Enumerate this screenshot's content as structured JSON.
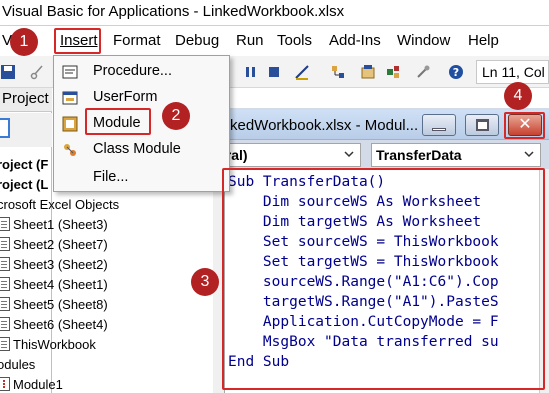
{
  "window": {
    "title": "Visual Basic for Applications - LinkedWorkbook.xlsx"
  },
  "menu": {
    "items": [
      "Insert",
      "Format",
      "Debug",
      "Run",
      "Tools",
      "Add-Ins",
      "Window",
      "Help"
    ],
    "clipped_first": "V"
  },
  "toolbar": {
    "position": "Ln 11, Col"
  },
  "insert_menu": {
    "items": [
      "Procedure...",
      "UserForm",
      "Module",
      "Class Module",
      "File..."
    ]
  },
  "project": {
    "header": "Project",
    "tree": [
      "roject (F",
      "roject (L",
      "crosoft Excel Objects",
      "Sheet1 (Sheet3)",
      "Sheet2 (Sheet7)",
      "Sheet3 (Sheet2)",
      "Sheet4 (Sheet1)",
      "Sheet5 (Sheet8)",
      "Sheet6 (Sheet4)",
      "ThisWorkbook",
      "odules",
      "Module1"
    ]
  },
  "code_window": {
    "caption": "kedWorkbook.xlsx - Modul...",
    "object_combo": "eral)",
    "procedure_combo": "TransferData",
    "lines": [
      "Sub TransferData()",
      "    Dim sourceWS As Worksheet",
      "    Dim targetWS As Worksheet",
      "    Set sourceWS = ThisWorkbook",
      "    Set targetWS = ThisWorkbook",
      "    sourceWS.Range(\"A1:C6\").Cop",
      "    targetWS.Range(\"A1\").PasteS",
      "    Application.CutCopyMode = F",
      "    MsgBox \"Data transferred su",
      "End Sub"
    ]
  },
  "annotations": {
    "steps": [
      "1",
      "2",
      "3",
      "4"
    ],
    "highlight_color": "#d62828",
    "badge_color": "#b22222"
  }
}
